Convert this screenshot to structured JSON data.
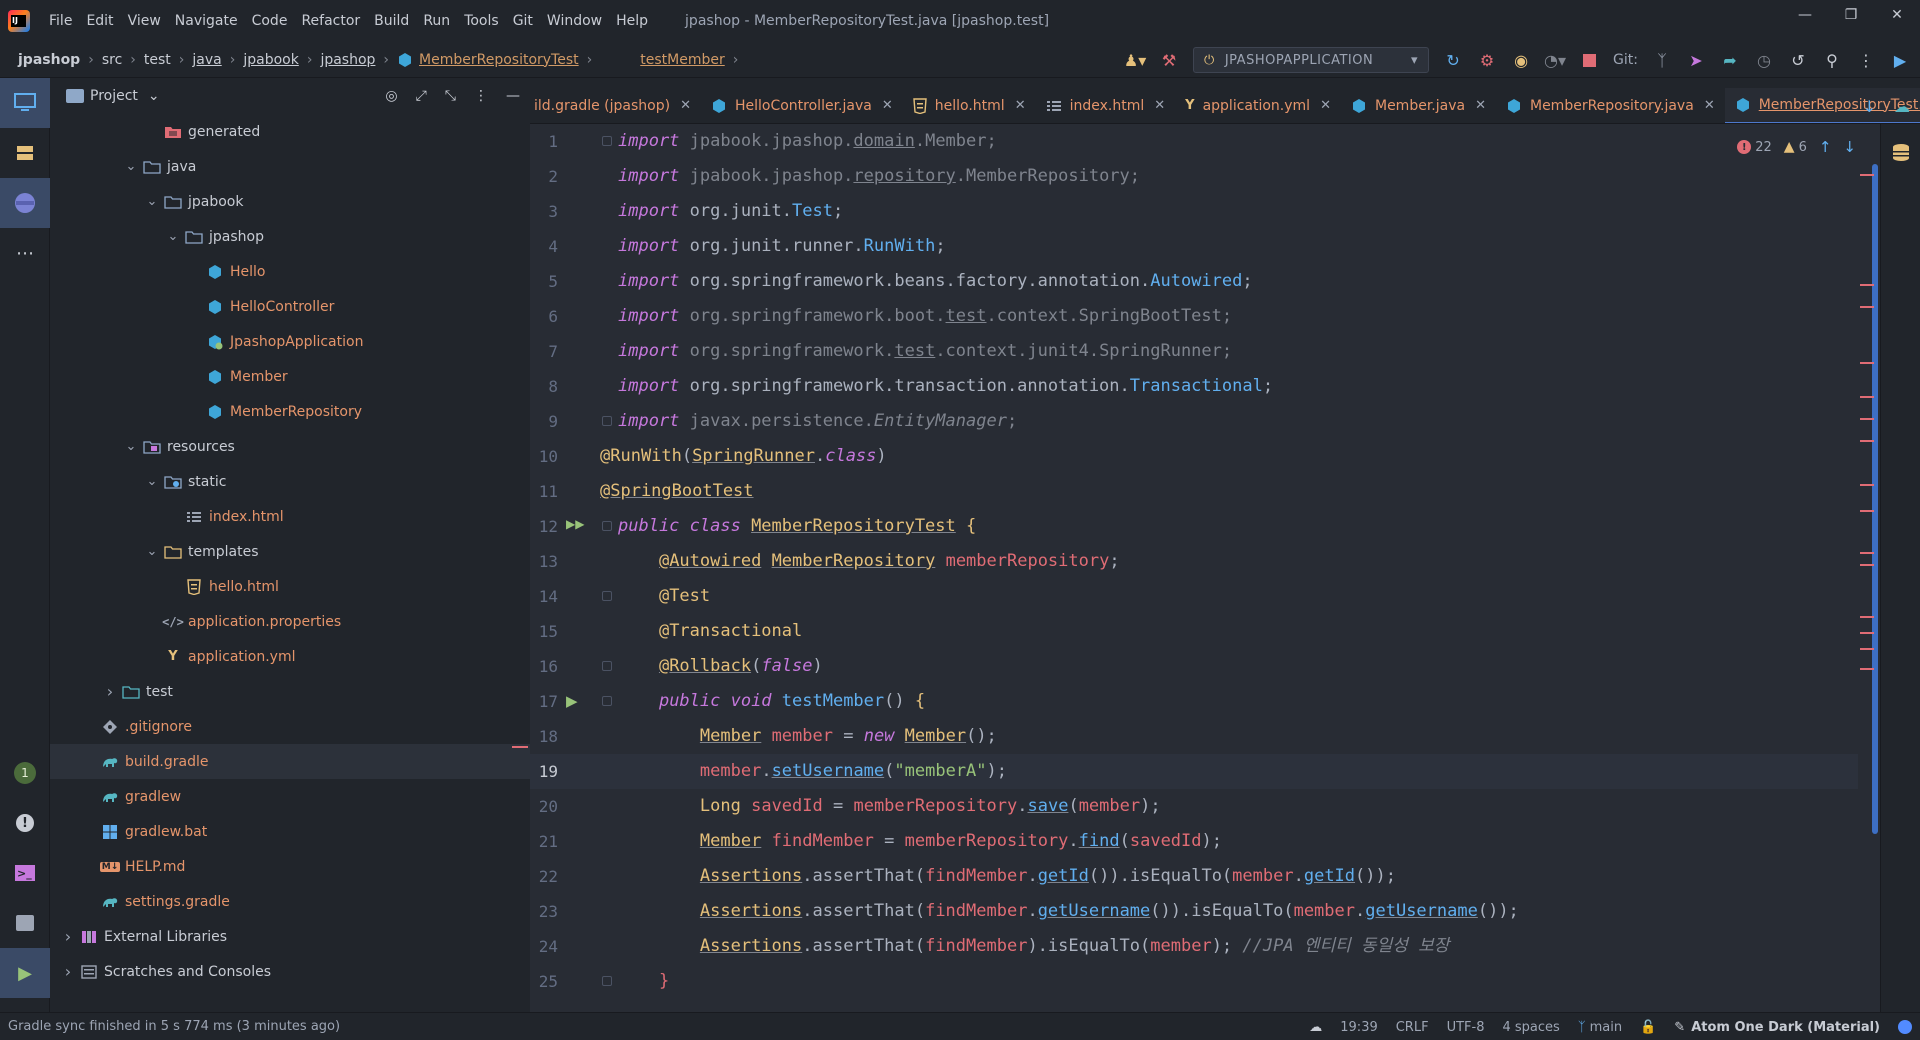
{
  "menu": {
    "items": [
      "File",
      "Edit",
      "View",
      "Navigate",
      "Code",
      "Refactor",
      "Build",
      "Run",
      "Tools",
      "Git",
      "Window",
      "Help"
    ],
    "title": "jpashop - MemberRepositoryTest.java [jpashop.test]"
  },
  "breadcrumb": {
    "project": "jpashop",
    "src": "src",
    "test": "test",
    "java": "java",
    "pkg1": "jpabook",
    "pkg2": "jpashop",
    "cls": "MemberRepositoryTest",
    "method": "testMember"
  },
  "toolbar": {
    "run_config": "JPASHOPAPPLICATION",
    "git_label": "Git:"
  },
  "project_panel": {
    "title": "Project",
    "tree": [
      {
        "label": "generated",
        "depth": 4,
        "caret": "",
        "icon": "folder-generated",
        "mod": false
      },
      {
        "label": "java",
        "depth": 3,
        "caret": "down",
        "icon": "folder",
        "mod": false
      },
      {
        "label": "jpabook",
        "depth": 4,
        "caret": "down",
        "icon": "folder",
        "mod": false
      },
      {
        "label": "jpashop",
        "depth": 5,
        "caret": "down",
        "icon": "folder",
        "mod": false
      },
      {
        "label": "Hello",
        "depth": 6,
        "caret": "",
        "icon": "class",
        "mod": true
      },
      {
        "label": "HelloController",
        "depth": 6,
        "caret": "",
        "icon": "class",
        "mod": true
      },
      {
        "label": "JpashopApplication",
        "depth": 6,
        "caret": "",
        "icon": "spring-class",
        "mod": true
      },
      {
        "label": "Member",
        "depth": 6,
        "caret": "",
        "icon": "class",
        "mod": true
      },
      {
        "label": "MemberRepository",
        "depth": 6,
        "caret": "",
        "icon": "class",
        "mod": true
      },
      {
        "label": "resources",
        "depth": 3,
        "caret": "down",
        "icon": "folder-resources",
        "mod": false
      },
      {
        "label": "static",
        "depth": 4,
        "caret": "down",
        "icon": "folder-web",
        "mod": false
      },
      {
        "label": "index.html",
        "depth": 5,
        "caret": "",
        "icon": "html-list",
        "mod": true
      },
      {
        "label": "templates",
        "depth": 4,
        "caret": "down",
        "icon": "folder-templates",
        "mod": false
      },
      {
        "label": "hello.html",
        "depth": 5,
        "caret": "",
        "icon": "html",
        "mod": true
      },
      {
        "label": "application.properties",
        "depth": 4,
        "caret": "",
        "icon": "properties",
        "mod": true
      },
      {
        "label": "application.yml",
        "depth": 4,
        "caret": "",
        "icon": "yml",
        "mod": true
      },
      {
        "label": "test",
        "depth": 2,
        "caret": "right",
        "icon": "folder-test",
        "mod": false
      },
      {
        "label": ".gitignore",
        "depth": 1,
        "caret": "",
        "icon": "gitignore",
        "mod": true
      },
      {
        "label": "build.gradle",
        "depth": 1,
        "caret": "",
        "icon": "gradle",
        "mod": true,
        "selected": true
      },
      {
        "label": "gradlew",
        "depth": 1,
        "caret": "",
        "icon": "gradle",
        "mod": true
      },
      {
        "label": "gradlew.bat",
        "depth": 1,
        "caret": "",
        "icon": "windows",
        "mod": true
      },
      {
        "label": "HELP.md",
        "depth": 1,
        "caret": "",
        "icon": "markdown",
        "mod": true
      },
      {
        "label": "settings.gradle",
        "depth": 1,
        "caret": "",
        "icon": "gradle",
        "mod": true
      },
      {
        "label": "External Libraries",
        "depth": 0,
        "caret": "right",
        "icon": "libraries",
        "mod": false
      },
      {
        "label": "Scratches and Consoles",
        "depth": 0,
        "caret": "right",
        "icon": "scratches",
        "mod": false
      }
    ]
  },
  "tabs": [
    {
      "label": "ild.gradle (jpashop)",
      "icon": "",
      "active": false
    },
    {
      "label": "HelloController.java",
      "icon": "class",
      "active": false
    },
    {
      "label": "hello.html",
      "icon": "html",
      "active": false
    },
    {
      "label": "index.html",
      "icon": "html-list",
      "active": false
    },
    {
      "label": "application.yml",
      "icon": "yml",
      "active": false
    },
    {
      "label": "Member.java",
      "icon": "class",
      "active": false
    },
    {
      "label": "MemberRepository.java",
      "icon": "class",
      "active": false
    },
    {
      "label": "MemberRepositoryTest.java",
      "icon": "class",
      "active": true
    }
  ],
  "inspections": {
    "errors": "22",
    "warnings": "6"
  },
  "editor": {
    "current_line": 19,
    "lines": [
      [
        [
          "kw",
          "import"
        ],
        [
          "dm",
          " jpabook.jpashop."
        ],
        [
          "dm ul",
          "domain"
        ],
        [
          "dm",
          ".Member;"
        ]
      ],
      [
        [
          "kw",
          "import"
        ],
        [
          "dm",
          " jpabook.jpashop."
        ],
        [
          "dm ul",
          "repository"
        ],
        [
          "dm",
          ".MemberRepository;"
        ]
      ],
      [
        [
          "kw",
          "import"
        ],
        [
          "p",
          " org.junit."
        ],
        [
          "fn",
          "Test"
        ],
        [
          "p",
          ";"
        ]
      ],
      [
        [
          "kw",
          "import"
        ],
        [
          "p",
          " org.junit.runner."
        ],
        [
          "fn",
          "RunWith"
        ],
        [
          "p",
          ";"
        ]
      ],
      [
        [
          "kw",
          "import"
        ],
        [
          "p",
          " org.springframework.beans.factory.annotation."
        ],
        [
          "fn",
          "Autowired"
        ],
        [
          "p",
          ";"
        ]
      ],
      [
        [
          "kw",
          "import"
        ],
        [
          "dm",
          " org.springframework.boot."
        ],
        [
          "dm ul",
          "test"
        ],
        [
          "dm",
          ".context.SpringBootTest;"
        ]
      ],
      [
        [
          "kw",
          "import"
        ],
        [
          "dm",
          " org.springframework."
        ],
        [
          "dm ul",
          "test"
        ],
        [
          "dm",
          ".context.junit4.SpringRunner;"
        ]
      ],
      [
        [
          "kw",
          "import"
        ],
        [
          "p",
          " org.springframework.transaction.annotation."
        ],
        [
          "fn",
          "Transactional"
        ],
        [
          "p",
          ";"
        ]
      ],
      [
        [
          "kw",
          "import"
        ],
        [
          "dm",
          " javax.persistence."
        ],
        [
          "dm it",
          "EntityManager"
        ],
        [
          "dm",
          ";"
        ]
      ],
      [
        [
          "an",
          "@RunWith"
        ],
        [
          "p",
          "("
        ],
        [
          "ty ul",
          "SpringRunner"
        ],
        [
          "p",
          "."
        ],
        [
          "kw",
          "class"
        ],
        [
          "p",
          ")"
        ]
      ],
      [
        [
          "an ul",
          "@SpringBootTest"
        ]
      ],
      [
        [
          "kw",
          "public class "
        ],
        [
          "ty ul",
          "MemberRepositoryTest"
        ],
        [
          "ty",
          " {"
        ]
      ],
      [
        [
          "p",
          "    "
        ],
        [
          "an ul",
          "@Autowired"
        ],
        [
          "p",
          " "
        ],
        [
          "ty ul",
          "MemberRepository"
        ],
        [
          "p",
          " "
        ],
        [
          "vr",
          "memberRepository"
        ],
        [
          "p",
          ";"
        ]
      ],
      [
        [
          "p",
          "    "
        ],
        [
          "an",
          "@Test"
        ]
      ],
      [
        [
          "p",
          "    "
        ],
        [
          "an",
          "@Transactional"
        ]
      ],
      [
        [
          "p",
          "    "
        ],
        [
          "an ul",
          "@Rollback"
        ],
        [
          "p",
          "("
        ],
        [
          "kw",
          "false"
        ],
        [
          "p",
          ")"
        ]
      ],
      [
        [
          "p",
          "    "
        ],
        [
          "kw",
          "public void "
        ],
        [
          "fn",
          "testMember"
        ],
        [
          "p",
          "() "
        ],
        [
          "ty",
          "{"
        ]
      ],
      [
        [
          "p",
          "        "
        ],
        [
          "ty ul",
          "Member"
        ],
        [
          "p",
          " "
        ],
        [
          "vr",
          "member"
        ],
        [
          "p",
          " = "
        ],
        [
          "kw",
          "new "
        ],
        [
          "ty ul",
          "Member"
        ],
        [
          "p",
          "();"
        ]
      ],
      [
        [
          "p",
          "        "
        ],
        [
          "vr",
          "member"
        ],
        [
          "p",
          "."
        ],
        [
          "fn ul",
          "setUsername"
        ],
        [
          "p",
          "("
        ],
        [
          "st",
          "\"memberA\""
        ],
        [
          "p",
          ");"
        ]
      ],
      [
        [
          "p",
          "        "
        ],
        [
          "ty",
          "Long"
        ],
        [
          "p",
          " "
        ],
        [
          "vr",
          "savedId"
        ],
        [
          "p",
          " = "
        ],
        [
          "vr",
          "memberRepository"
        ],
        [
          "p",
          "."
        ],
        [
          "fn ul",
          "save"
        ],
        [
          "p",
          "("
        ],
        [
          "vr",
          "member"
        ],
        [
          "p",
          ");"
        ]
      ],
      [
        [
          "p",
          "        "
        ],
        [
          "ty ul",
          "Member"
        ],
        [
          "p",
          " "
        ],
        [
          "vr",
          "findMember"
        ],
        [
          "p",
          " = "
        ],
        [
          "vr",
          "memberRepository"
        ],
        [
          "p",
          "."
        ],
        [
          "fn ul",
          "find"
        ],
        [
          "p",
          "("
        ],
        [
          "vr",
          "savedId"
        ],
        [
          "p",
          ");"
        ]
      ],
      [
        [
          "p",
          "        "
        ],
        [
          "ty ul",
          "Assertions"
        ],
        [
          "p",
          ".assertThat("
        ],
        [
          "vr",
          "findMember"
        ],
        [
          "p",
          "."
        ],
        [
          "fn ul",
          "getId"
        ],
        [
          "p",
          "()).isEqualTo("
        ],
        [
          "vr",
          "member"
        ],
        [
          "p",
          "."
        ],
        [
          "fn ul",
          "getId"
        ],
        [
          "p",
          "());"
        ]
      ],
      [
        [
          "p",
          "        "
        ],
        [
          "ty ul",
          "Assertions"
        ],
        [
          "p",
          ".assertThat("
        ],
        [
          "vr",
          "findMember"
        ],
        [
          "p",
          "."
        ],
        [
          "fn ul",
          "getUsername"
        ],
        [
          "p",
          "()).isEqualTo("
        ],
        [
          "vr",
          "member"
        ],
        [
          "p",
          "."
        ],
        [
          "fn ul",
          "getUsername"
        ],
        [
          "p",
          "());"
        ]
      ],
      [
        [
          "p",
          "        "
        ],
        [
          "ty ul",
          "Assertions"
        ],
        [
          "p",
          ".assertThat("
        ],
        [
          "vr",
          "findMember"
        ],
        [
          "p",
          ").isEqualTo("
        ],
        [
          "vr",
          "member"
        ],
        [
          "p",
          "); "
        ],
        [
          "cm",
          "//JPA 엔티티 동일성 보장"
        ]
      ],
      [
        [
          "p",
          "    "
        ],
        [
          "vr",
          "}"
        ]
      ]
    ]
  },
  "status": {
    "message": "Gradle sync finished in 5 s 774 ms (3 minutes ago)",
    "position": "19:39",
    "line_sep": "CRLF",
    "encoding": "UTF-8",
    "indent": "4 spaces",
    "branch": "main",
    "theme": "Atom One Dark (Material)"
  },
  "colors": {
    "editor_bg": "#282c34",
    "panel_bg": "#21252b",
    "accent": "#4d78cc",
    "modified": "#e5956b",
    "keyword": "#c678dd",
    "function": "#61afef",
    "type": "#e5c07b",
    "string": "#98c379",
    "variable": "#e06c75"
  }
}
